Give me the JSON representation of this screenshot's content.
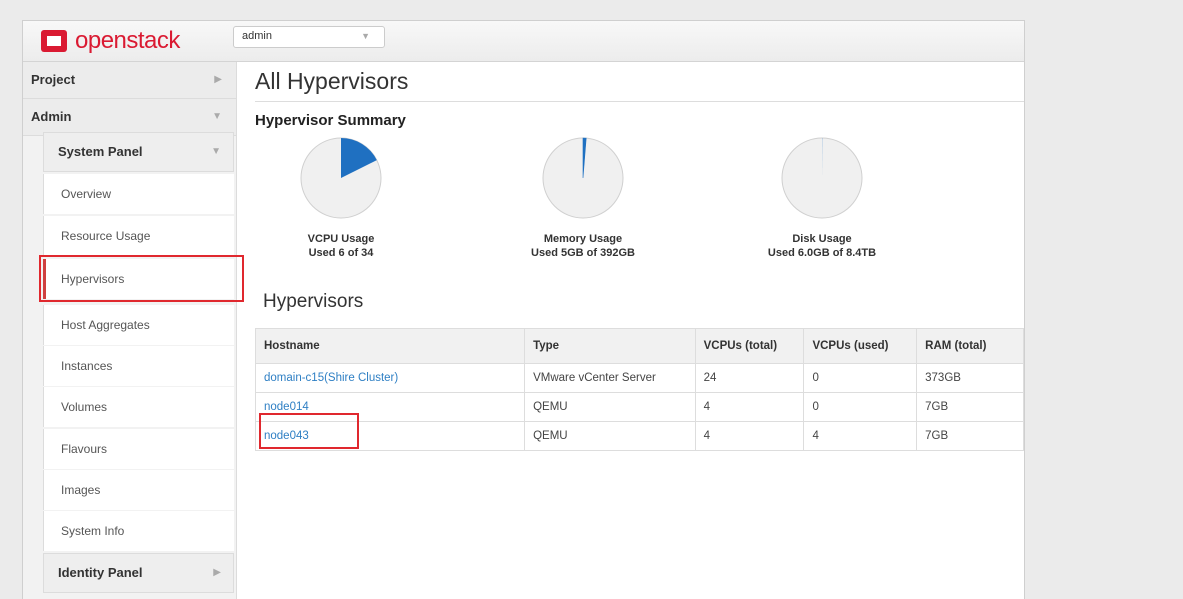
{
  "app": {
    "brand_red": "openstack",
    "brand_dark": ""
  },
  "project_selector": {
    "value": "admin"
  },
  "sidebar": {
    "project": "Project",
    "admin": "Admin",
    "system_panel": "System Panel",
    "items": [
      "Overview",
      "Resource Usage",
      "Hypervisors",
      "Host Aggregates",
      "Instances",
      "Volumes",
      "Flavours",
      "Images",
      "System Info"
    ],
    "active": "Hypervisors",
    "identity_panel": "Identity Panel"
  },
  "page": {
    "title": "All Hypervisors",
    "summary_title": "Hypervisor Summary",
    "table_title": "Hypervisors"
  },
  "summary": [
    {
      "label": "VCPU Usage",
      "detail": "Used 6 of 34",
      "used": 6,
      "total": 34
    },
    {
      "label": "Memory Usage",
      "detail": "Used 5GB of 392GB",
      "used": 5,
      "total": 392
    },
    {
      "label": "Disk Usage",
      "detail": "Used 6.0GB of 8.4TB",
      "used": 6.0,
      "total": 8600
    }
  ],
  "table": {
    "columns": [
      "Hostname",
      "Type",
      "VCPUs (total)",
      "VCPUs (used)",
      "RAM (total)"
    ],
    "rows": [
      [
        "domain-c15(Shire Cluster)",
        "VMware vCenter Server",
        "24",
        "0",
        "373GB"
      ],
      [
        "node014",
        "QEMU",
        "4",
        "0",
        "7GB"
      ],
      [
        "node043",
        "QEMU",
        "4",
        "4",
        "7GB"
      ]
    ]
  },
  "colors": {
    "pie_fill": "#1f70c1",
    "pie_bg": "#f0f0f0",
    "link": "#2e7fc4",
    "highlight": "#e0282e"
  }
}
